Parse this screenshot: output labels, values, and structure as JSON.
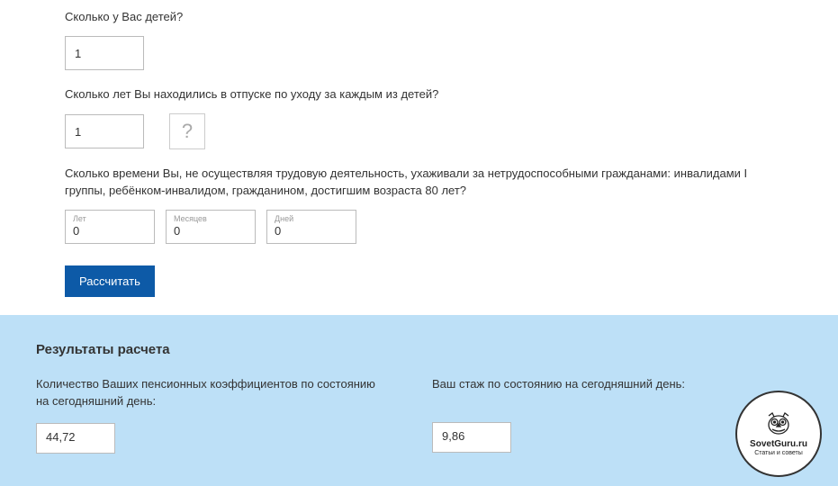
{
  "q_children": "Сколько у Вас детей?",
  "children_value": "1",
  "q_leave_years": "Сколько лет Вы находились в отпуске по уходу за каждым из детей?",
  "leave_years_value": "1",
  "q_care": "Сколько времени Вы, не осуществляя трудовую деятельность, ухаживали за нетрудоспособными гражданами: инвалидами I группы, ребёнком-инвалидом, гражданином, достигшим возраста 80 лет?",
  "care": {
    "years_label": "Лет",
    "years_value": "0",
    "months_label": "Месяцев",
    "months_value": "0",
    "days_label": "Дней",
    "days_value": "0"
  },
  "calculate_label": "Рассчитать",
  "results": {
    "title": "Результаты расчета",
    "coef_label": "Количество Ваших пенсионных коэффициентов по состоянию на сегодняшний день:",
    "coef_value": "44,72",
    "stage_label": "Ваш стаж по состоянию на сегодняшний день:",
    "stage_value": "9,86"
  },
  "watermark": {
    "line1": "SovetGuru.ru",
    "line2": "Статьи и советы"
  }
}
